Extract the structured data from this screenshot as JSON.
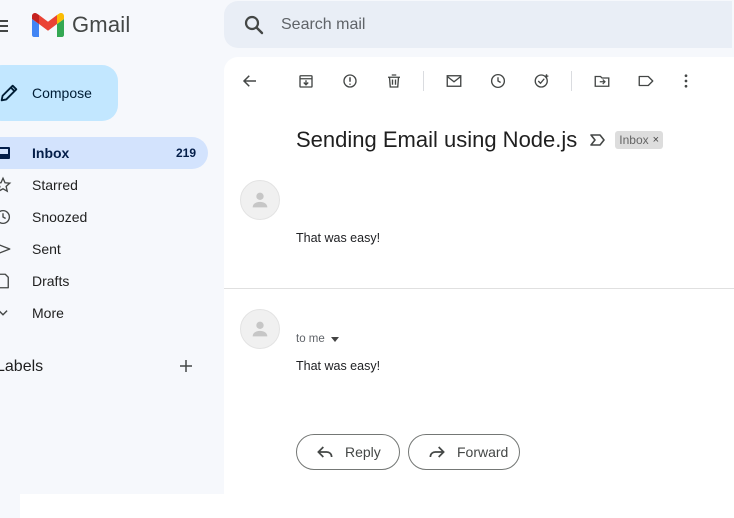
{
  "app": {
    "name": "Gmail"
  },
  "search": {
    "placeholder": "Search mail"
  },
  "compose": {
    "label": "Compose"
  },
  "nav": [
    {
      "label": "Inbox",
      "count": "219",
      "icon": "inbox-icon",
      "active": true
    },
    {
      "label": "Starred",
      "count": "",
      "icon": "star-icon"
    },
    {
      "label": "Snoozed",
      "count": "",
      "icon": "clock-icon"
    },
    {
      "label": "Sent",
      "count": "",
      "icon": "send-icon"
    },
    {
      "label": "Drafts",
      "count": "",
      "icon": "draft-icon"
    },
    {
      "label": "More",
      "count": "",
      "icon": "chevron-down-icon"
    }
  ],
  "labels": {
    "title": "Labels"
  },
  "email": {
    "subject": "Sending Email using Node.js",
    "badge": "Inbox",
    "messages": [
      {
        "body": "That was easy!"
      },
      {
        "recipient": "to me",
        "body": "That was easy!"
      }
    ]
  },
  "actions": {
    "reply": "Reply",
    "forward": "Forward"
  },
  "colors": {
    "compose_bg": "#c2e7ff",
    "active_nav": "#d3e3fd",
    "search_bg": "#e9eef6",
    "background": "#f6f8fc"
  }
}
